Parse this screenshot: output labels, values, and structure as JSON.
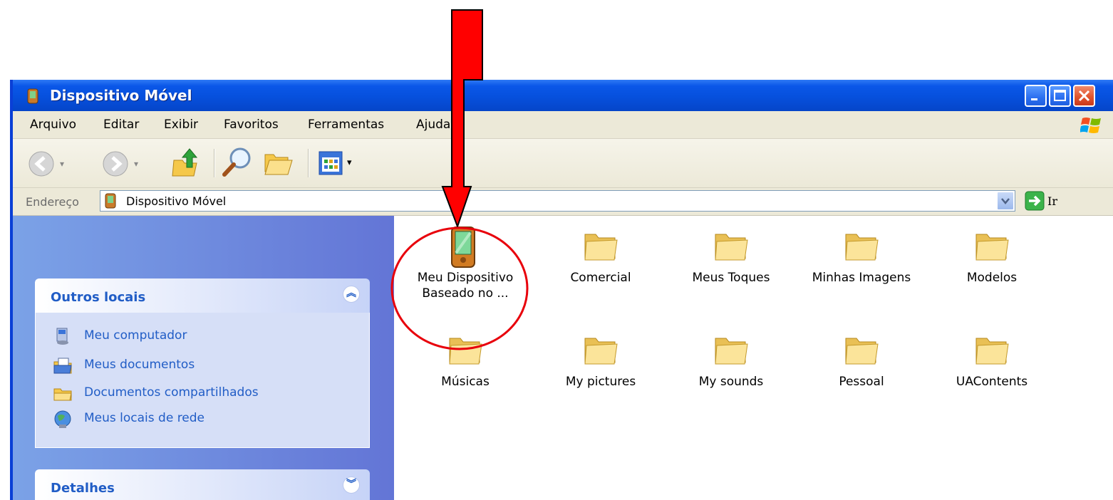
{
  "window": {
    "title": "Dispositivo Móvel",
    "title_icon": "pda-device-icon"
  },
  "menu": {
    "items": [
      {
        "label": "Arquivo"
      },
      {
        "label": "Editar"
      },
      {
        "label": "Exibir"
      },
      {
        "label": "Favoritos"
      },
      {
        "label": "Ferramentas"
      },
      {
        "label": "Ajuda"
      }
    ]
  },
  "toolbar": {
    "buttons": [
      "back-icon",
      "forward-icon",
      "up-folder-icon",
      "search-icon",
      "folders-icon",
      "views-icon"
    ]
  },
  "address": {
    "label": "Endereço",
    "value": "Dispositivo Móvel",
    "go_label": "Ir"
  },
  "sidebar": {
    "other_places": {
      "title": "Outros locais",
      "links": [
        {
          "label": "Meu computador",
          "icon": "computer-icon"
        },
        {
          "label": "Meus documentos",
          "icon": "documents-icon"
        },
        {
          "label": "Documentos compartilhados",
          "icon": "shared-folder-icon"
        },
        {
          "label": "Meus locais de rede",
          "icon": "network-icon"
        }
      ]
    },
    "details": {
      "title": "Detalhes"
    }
  },
  "content": {
    "items": [
      {
        "label_line1": "Meu Dispositivo",
        "label_line2": "Baseado no ...",
        "icon": "pda-device-icon"
      },
      {
        "label_line1": "Comercial",
        "icon": "folder-icon"
      },
      {
        "label_line1": "Meus Toques",
        "icon": "folder-icon"
      },
      {
        "label_line1": "Minhas Imagens",
        "icon": "folder-icon"
      },
      {
        "label_line1": "Modelos",
        "icon": "folder-icon"
      },
      {
        "label_line1": "Músicas",
        "icon": "folder-icon"
      },
      {
        "label_line1": "My pictures",
        "icon": "folder-icon"
      },
      {
        "label_line1": "My sounds",
        "icon": "folder-icon"
      },
      {
        "label_line1": "Pessoal",
        "icon": "folder-icon"
      },
      {
        "label_line1": "UAContents",
        "icon": "folder-icon"
      }
    ]
  },
  "annotation": {
    "arrow_color": "#ff0000",
    "circle_color": "#e8000b"
  },
  "colors": {
    "titlebar": "#0a57e8",
    "link": "#215dc6",
    "sidebar": "#7ba2e7"
  }
}
